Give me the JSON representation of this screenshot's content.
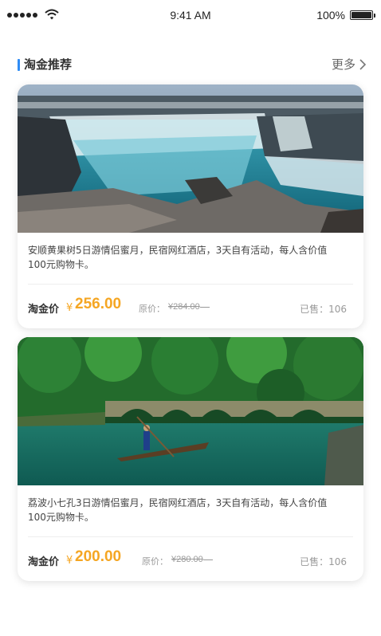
{
  "status_bar": {
    "time": "9:41 AM",
    "battery": "100%"
  },
  "section": {
    "title": "淘金推荐",
    "more": "更多"
  },
  "cards": [
    {
      "description": "安顺黄果树5日游情侣蜜月，民宿网红酒店，3天自有活动，每人含价值100元购物卡。",
      "price_label": "淘金价",
      "currency": "¥",
      "price": "256.00",
      "original_label": "原价：",
      "original_price": "¥284.00",
      "sold": "已售：106",
      "image": "waterfall-photo"
    },
    {
      "description": "荔波小七孔3日游情侣蜜月，民宿网红酒店，3天自有活动，每人含价值100元购物卡。",
      "price_label": "淘金价",
      "currency": "¥",
      "price": "200.00",
      "original_label": "原价：",
      "original_price": "¥280.00",
      "sold": "已售：106",
      "image": "bridge-river-photo"
    }
  ],
  "colors": {
    "accent": "#2f8cf5",
    "price": "#f5a623"
  }
}
